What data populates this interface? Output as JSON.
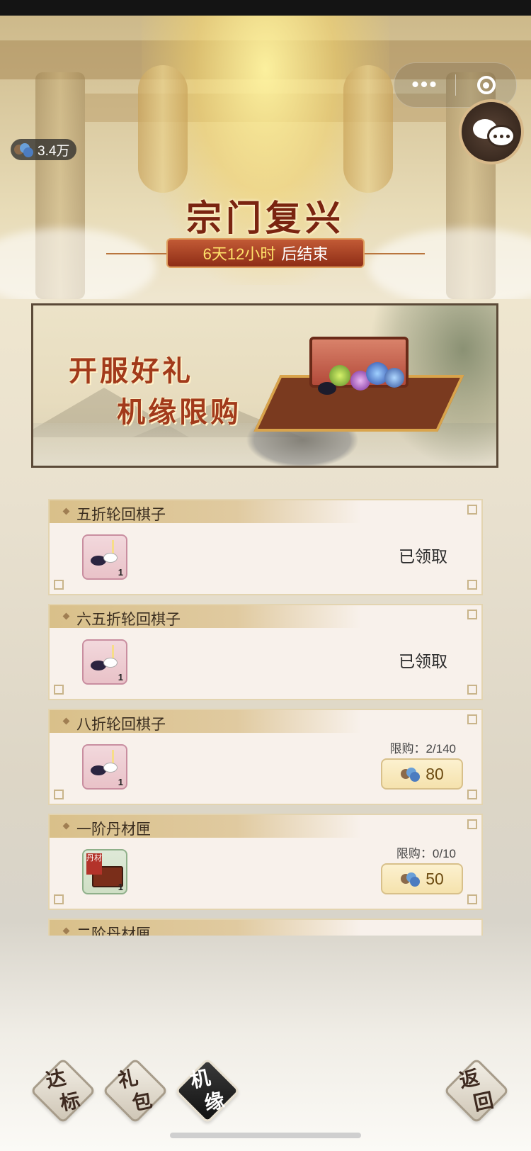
{
  "topbar": {
    "currency_amount": "3.4万"
  },
  "event": {
    "title": "宗门复兴",
    "timer_value": "6天12小时",
    "timer_suffix": "后结束"
  },
  "banner": {
    "line1": "开服好礼",
    "line2": "机缘限购"
  },
  "items": [
    {
      "name": "五折轮回棋子",
      "count": "1",
      "status": "已领取"
    },
    {
      "name": "六五折轮回棋子",
      "count": "1",
      "status": "已领取"
    },
    {
      "name": "八折轮回棋子",
      "count": "1",
      "limit": "限购：2/140",
      "price": "80"
    },
    {
      "name": "一阶丹材匣",
      "count": "1",
      "icon_tag": "丹材",
      "limit": "限购：0/10",
      "price": "50"
    },
    {
      "name": "二阶丹材匣"
    }
  ],
  "nav": {
    "tab1": [
      "达",
      "标"
    ],
    "tab2": [
      "礼",
      "包"
    ],
    "tab3": [
      "机",
      "缘"
    ],
    "back": [
      "返",
      "回"
    ]
  },
  "colors": {
    "title_red": "#7a2410",
    "banner_red": "#a23a1b",
    "price_brown": "#6d4c12"
  },
  "icons": [
    "more-dots-icon",
    "target-icon",
    "chat-icon",
    "spirit-stone-icon"
  ]
}
